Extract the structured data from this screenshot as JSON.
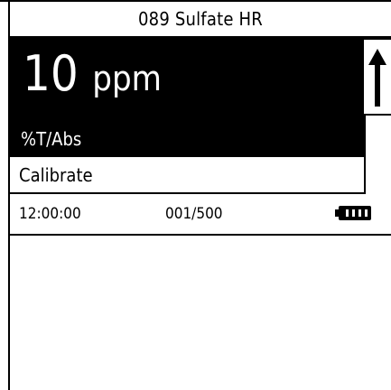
{
  "header": {
    "title": "089 Sulfate HR"
  },
  "reading": {
    "value": "10",
    "unit": "ppm",
    "mode_label": "%T/Abs"
  },
  "menu": {
    "calibrate_label": "Calibrate"
  },
  "status": {
    "time": "12:00:00",
    "sample_count": "001/500",
    "battery_icon": "battery-full-icon"
  },
  "scroll": {
    "icon": "arrow-up-icon"
  }
}
